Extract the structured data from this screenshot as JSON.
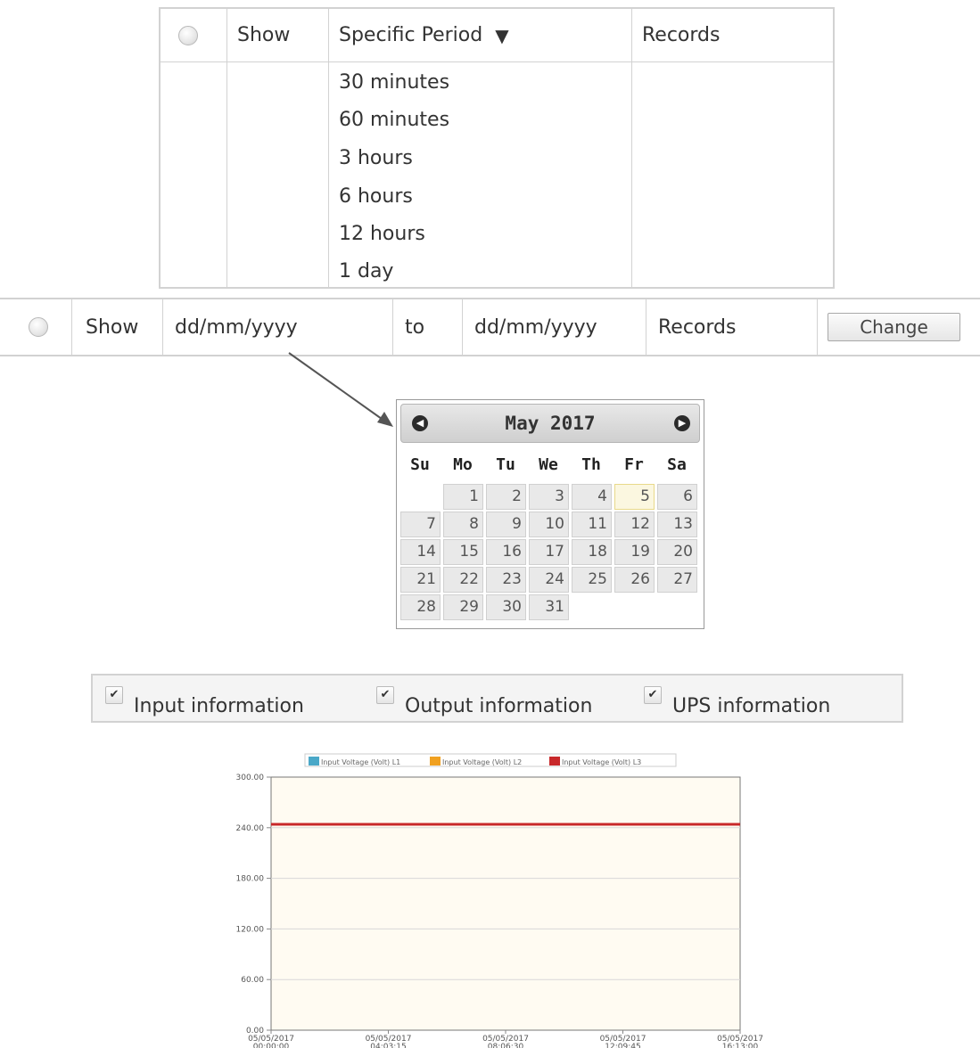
{
  "period_table": {
    "show_label": "Show",
    "select_value": "Specific Period",
    "select_arrow": "▼",
    "records_label": "Records",
    "options": [
      "30 minutes",
      "60 minutes",
      "3 hours",
      "6 hours",
      "12 hours",
      "1 day"
    ]
  },
  "range_row": {
    "show_label": "Show",
    "from_placeholder": "dd/mm/yyyy",
    "to_label": "to",
    "to_placeholder": "dd/mm/yyyy",
    "records_label": "Records",
    "change_label": "Change"
  },
  "calendar": {
    "title": "May 2017",
    "prev_icon": "◀",
    "next_icon": "▶",
    "weekdays": [
      "Su",
      "Mo",
      "Tu",
      "We",
      "Th",
      "Fr",
      "Sa"
    ],
    "first_weekday_index": 1,
    "days_in_month": 31,
    "highlighted_day": 5
  },
  "info_bar": {
    "items": [
      {
        "label": "Input information",
        "checked": true
      },
      {
        "label": "Output information",
        "checked": true
      },
      {
        "label": "UPS information",
        "checked": true
      }
    ]
  },
  "chart_data": {
    "type": "line",
    "title": "",
    "xlabel": "",
    "ylabel": "",
    "ylim": [
      0,
      300
    ],
    "yticks": [
      "300.00",
      "240.00",
      "180.00",
      "120.00",
      "60.00",
      "0.00"
    ],
    "xticks": [
      [
        "05/05/2017",
        "00:00:00"
      ],
      [
        "05/05/2017",
        "04:03:15"
      ],
      [
        "05/05/2017",
        "08:06:30"
      ],
      [
        "05/05/2017",
        "12:09:45"
      ],
      [
        "05/05/2017",
        "16:13:00"
      ]
    ],
    "grid": true,
    "legend_placement": "top",
    "series": [
      {
        "name": "Input Voltage (Volt) L1",
        "color": "#4aa8c8",
        "values": [
          244,
          244,
          244,
          244,
          244
        ]
      },
      {
        "name": "Input Voltage (Volt) L2",
        "color": "#f0a020",
        "values": [
          244,
          244,
          244,
          244,
          244
        ]
      },
      {
        "name": "Input Voltage (Volt) L3",
        "color": "#c8282a",
        "values": [
          244,
          244,
          244,
          244,
          244
        ]
      }
    ]
  },
  "colors": {
    "plot_background": "#fffbf2",
    "border": "#d2d2d2"
  }
}
